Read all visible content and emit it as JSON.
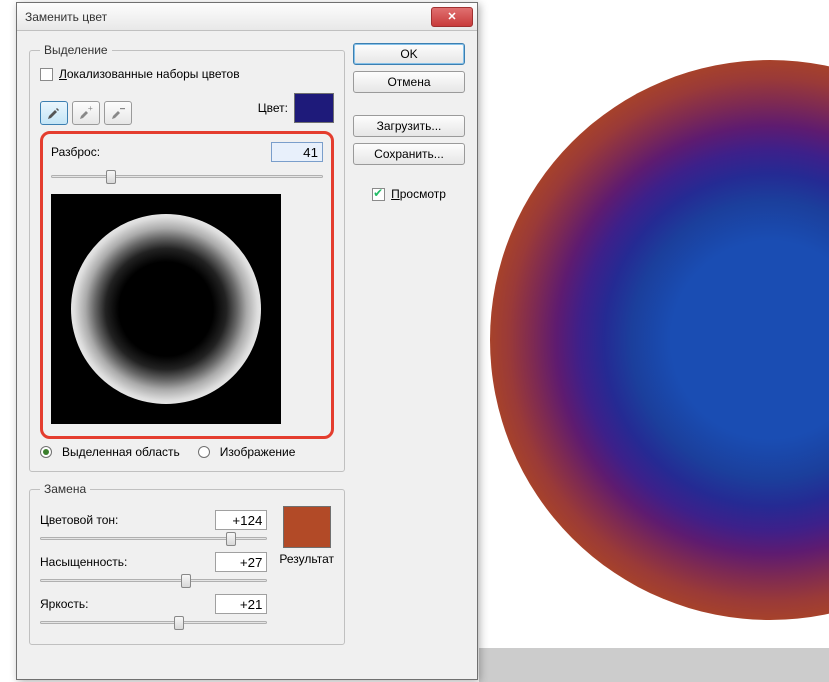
{
  "title": "Заменить цвет",
  "buttons": {
    "ok": "OK",
    "cancel": "Отмена",
    "load": "Загрузить...",
    "save": "Сохранить..."
  },
  "preview_checkbox": "Просмотр",
  "selection": {
    "legend": "Выделение",
    "localized": "Локализованные наборы цветов",
    "color_label": "Цвет:",
    "color_hex": "#1e1a7a",
    "fuzziness_label": "Разброс:",
    "fuzziness_value": "41",
    "radio_selection": "Выделенная область",
    "radio_image": "Изображение"
  },
  "replace": {
    "legend": "Замена",
    "hue_label": "Цветовой тон:",
    "hue_value": "+124",
    "sat_label": "Насыщенность:",
    "sat_value": "+27",
    "light_label": "Яркость:",
    "light_value": "+21",
    "result_label": "Результат",
    "result_hex": "#b24a27"
  }
}
